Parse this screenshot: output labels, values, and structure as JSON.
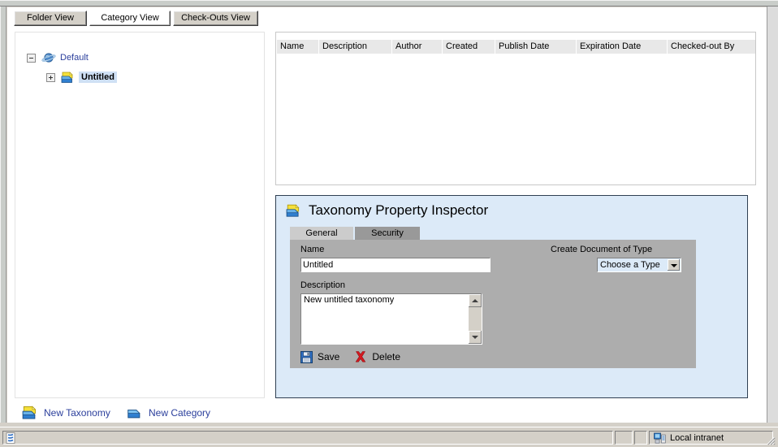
{
  "window": {
    "title": ""
  },
  "view_tabs": [
    {
      "label": "Folder View",
      "active": false
    },
    {
      "label": "Category View",
      "active": true
    },
    {
      "label": "Check-Outs View",
      "active": false
    }
  ],
  "tree": {
    "nodes": [
      {
        "label": "Default",
        "icon": "globe-icon",
        "expander": "minus",
        "selected": false
      },
      {
        "label": "Untitled",
        "icon": "taxonomy-icon",
        "expander": "plus",
        "selected": true
      }
    ]
  },
  "grid": {
    "columns": [
      {
        "label": "Name",
        "width": 52
      },
      {
        "label": "Description",
        "width": 90
      },
      {
        "label": "Author",
        "width": 62
      },
      {
        "label": "Created",
        "width": 65
      },
      {
        "label": "Publish Date",
        "width": 100
      },
      {
        "label": "Expiration Date",
        "width": 112
      },
      {
        "label": "Checked-out By",
        "width": 118
      }
    ],
    "rows": []
  },
  "inspector": {
    "title": "Taxonomy Property Inspector",
    "title_icon": "taxonomy-icon",
    "tabs": [
      {
        "label": "General",
        "active": true
      },
      {
        "label": "Security",
        "active": false
      }
    ],
    "fields": {
      "name_label": "Name",
      "name_value": "Untitled",
      "description_label": "Description",
      "description_value": "New untitled taxonomy",
      "create_type_label": "Create Document of Type",
      "create_type_value": "Choose a Type",
      "create_type_options": [
        "Choose a Type"
      ]
    },
    "actions": [
      {
        "label": "Save",
        "icon": "save-floppy-icon"
      },
      {
        "label": "Delete",
        "icon": "delete-x-icon"
      }
    ]
  },
  "command_bar": {
    "items": [
      {
        "label": "New Taxonomy",
        "icon": "taxonomy-icon"
      },
      {
        "label": "New Category",
        "icon": "category-icon"
      }
    ]
  },
  "status_bar": {
    "message": "",
    "zone_label": "Local intranet",
    "zone_icon": "intranet-zone-icon",
    "page_icon": "page-icon"
  },
  "colors": {
    "panel_background": "#dceaf8",
    "panel_border": "#2f3f52",
    "form_background": "#adadad",
    "link_text": "#2b3f9c",
    "selection": "#cfe0f4",
    "chrome": "#d4d0c8"
  }
}
